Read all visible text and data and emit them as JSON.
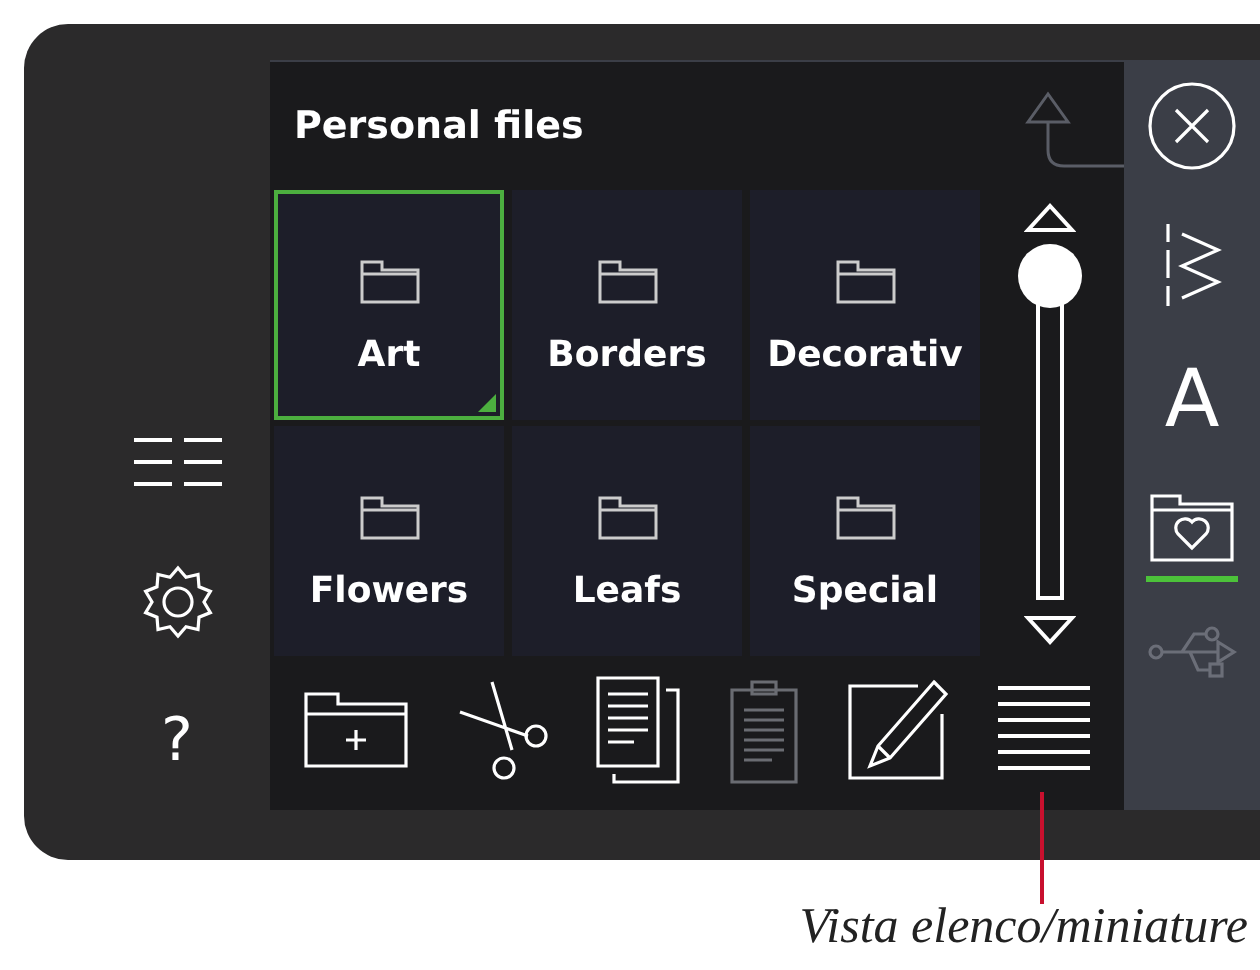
{
  "left_menu": [
    {
      "kind": "list-view"
    },
    {
      "kind": "settings"
    },
    {
      "kind": "help",
      "text": "?"
    }
  ],
  "panel": {
    "title": "Personal files",
    "folders": [
      {
        "label": "Art",
        "selected": true
      },
      {
        "label": "Borders",
        "selected": false
      },
      {
        "label": "Decorativ",
        "selected": false
      },
      {
        "label": "Flowers",
        "selected": false
      },
      {
        "label": "Leafs",
        "selected": false
      },
      {
        "label": "Special",
        "selected": false
      }
    ],
    "toolbar": [
      {
        "kind": "new-folder",
        "disabled": false
      },
      {
        "kind": "cut",
        "disabled": false
      },
      {
        "kind": "copy",
        "disabled": false
      },
      {
        "kind": "paste",
        "disabled": true
      },
      {
        "kind": "rename",
        "disabled": false
      },
      {
        "kind": "list-view",
        "disabled": false
      }
    ]
  },
  "sidebar": [
    {
      "kind": "close",
      "selected": false,
      "disabled": false
    },
    {
      "kind": "stitch",
      "selected": false,
      "disabled": false
    },
    {
      "kind": "font",
      "text": "A",
      "selected": false,
      "disabled": false
    },
    {
      "kind": "personal-folder",
      "selected": true,
      "disabled": false
    },
    {
      "kind": "usb",
      "selected": false,
      "disabled": true
    }
  ],
  "caption": "Vista elenco/miniature"
}
